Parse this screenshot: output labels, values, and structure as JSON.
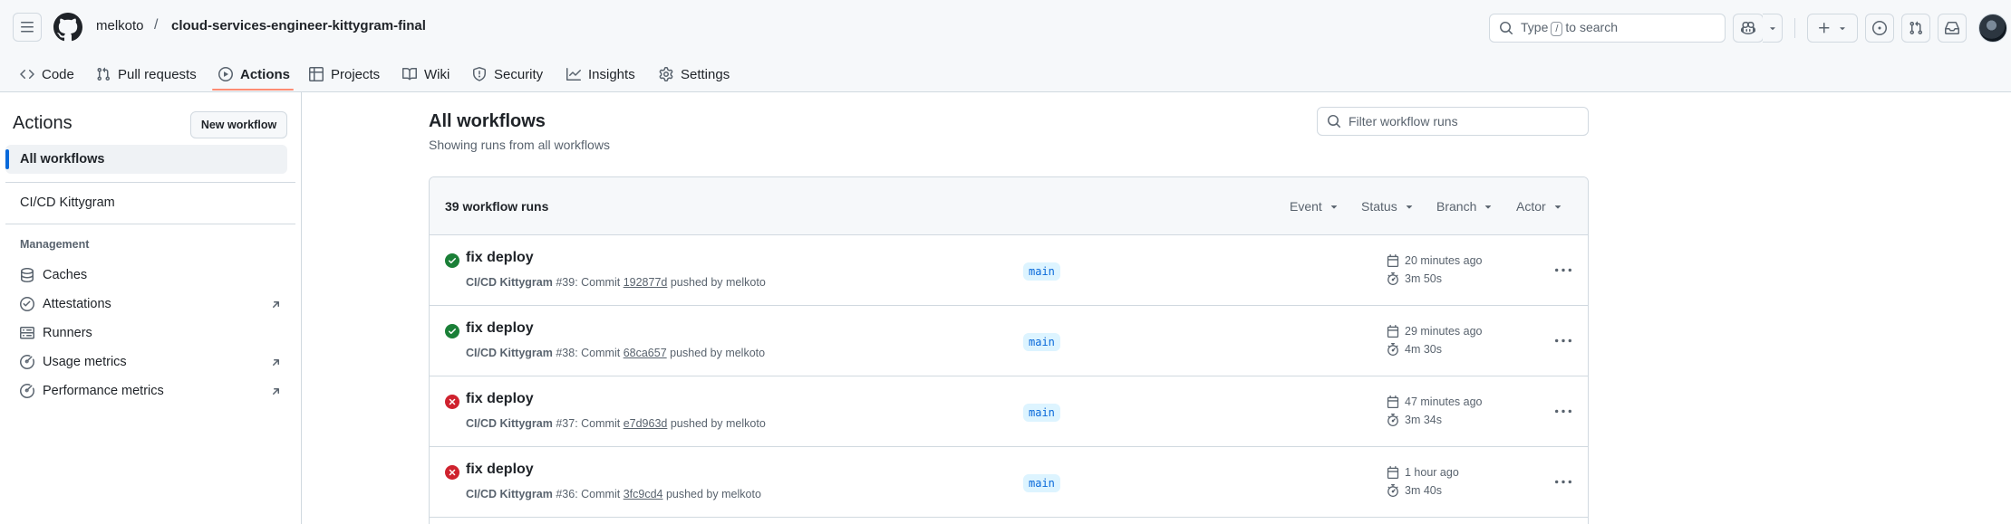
{
  "header": {
    "owner": "melkoto",
    "separator": "/",
    "repo": "cloud-services-engineer-kittygram-final",
    "search_prefix": "Type",
    "search_key": "/",
    "search_suffix": "to search"
  },
  "repo_nav": {
    "tabs": [
      {
        "label": "Code",
        "icon": "code-icon"
      },
      {
        "label": "Pull requests",
        "icon": "pull-request-icon"
      },
      {
        "label": "Actions",
        "icon": "play-icon",
        "active": true
      },
      {
        "label": "Projects",
        "icon": "table-icon"
      },
      {
        "label": "Wiki",
        "icon": "book-icon"
      },
      {
        "label": "Security",
        "icon": "shield-icon"
      },
      {
        "label": "Insights",
        "icon": "graph-icon"
      },
      {
        "label": "Settings",
        "icon": "gear-icon"
      }
    ],
    "active_color": "#fd8c73"
  },
  "sidebar": {
    "title": "Actions",
    "new_workflow": "New workflow",
    "all_workflows": "All workflows",
    "workflows": [
      "CI/CD Kittygram"
    ],
    "management_heading": "Management",
    "management": [
      {
        "label": "Caches",
        "icon": "database-icon",
        "external": false
      },
      {
        "label": "Attestations",
        "icon": "verified-icon",
        "external": true
      },
      {
        "label": "Runners",
        "icon": "server-icon",
        "external": false
      },
      {
        "label": "Usage metrics",
        "icon": "meter-icon",
        "external": true
      },
      {
        "label": "Performance metrics",
        "icon": "meter-icon",
        "external": true
      }
    ]
  },
  "main": {
    "title": "All workflows",
    "subtitle": "Showing runs from all workflows",
    "filter_placeholder": "Filter workflow runs",
    "runs_count": "39 workflow runs",
    "filters": [
      "Event",
      "Status",
      "Branch",
      "Actor"
    ],
    "runs": [
      {
        "status": "success",
        "title": "fix deploy",
        "workflow": "CI/CD Kittygram",
        "number": "#39",
        "commit_label": "Commit",
        "sha": "192877d",
        "pushed_by": "pushed by",
        "actor": "melkoto",
        "branch": "main",
        "time": "20 minutes ago",
        "duration": "3m 50s"
      },
      {
        "status": "success",
        "title": "fix deploy",
        "workflow": "CI/CD Kittygram",
        "number": "#38",
        "commit_label": "Commit",
        "sha": "68ca657",
        "pushed_by": "pushed by",
        "actor": "melkoto",
        "branch": "main",
        "time": "29 minutes ago",
        "duration": "4m 30s"
      },
      {
        "status": "failure",
        "title": "fix deploy",
        "workflow": "CI/CD Kittygram",
        "number": "#37",
        "commit_label": "Commit",
        "sha": "e7d963d",
        "pushed_by": "pushed by",
        "actor": "melkoto",
        "branch": "main",
        "time": "47 minutes ago",
        "duration": "3m 34s"
      },
      {
        "status": "failure",
        "title": "fix deploy",
        "workflow": "CI/CD Kittygram",
        "number": "#36",
        "commit_label": "Commit",
        "sha": "3fc9cd4",
        "pushed_by": "pushed by",
        "actor": "melkoto",
        "branch": "main",
        "time": "1 hour ago",
        "duration": "3m 40s"
      }
    ],
    "status_colors": {
      "success": "#1a7f37",
      "failure": "#cf222e"
    }
  }
}
